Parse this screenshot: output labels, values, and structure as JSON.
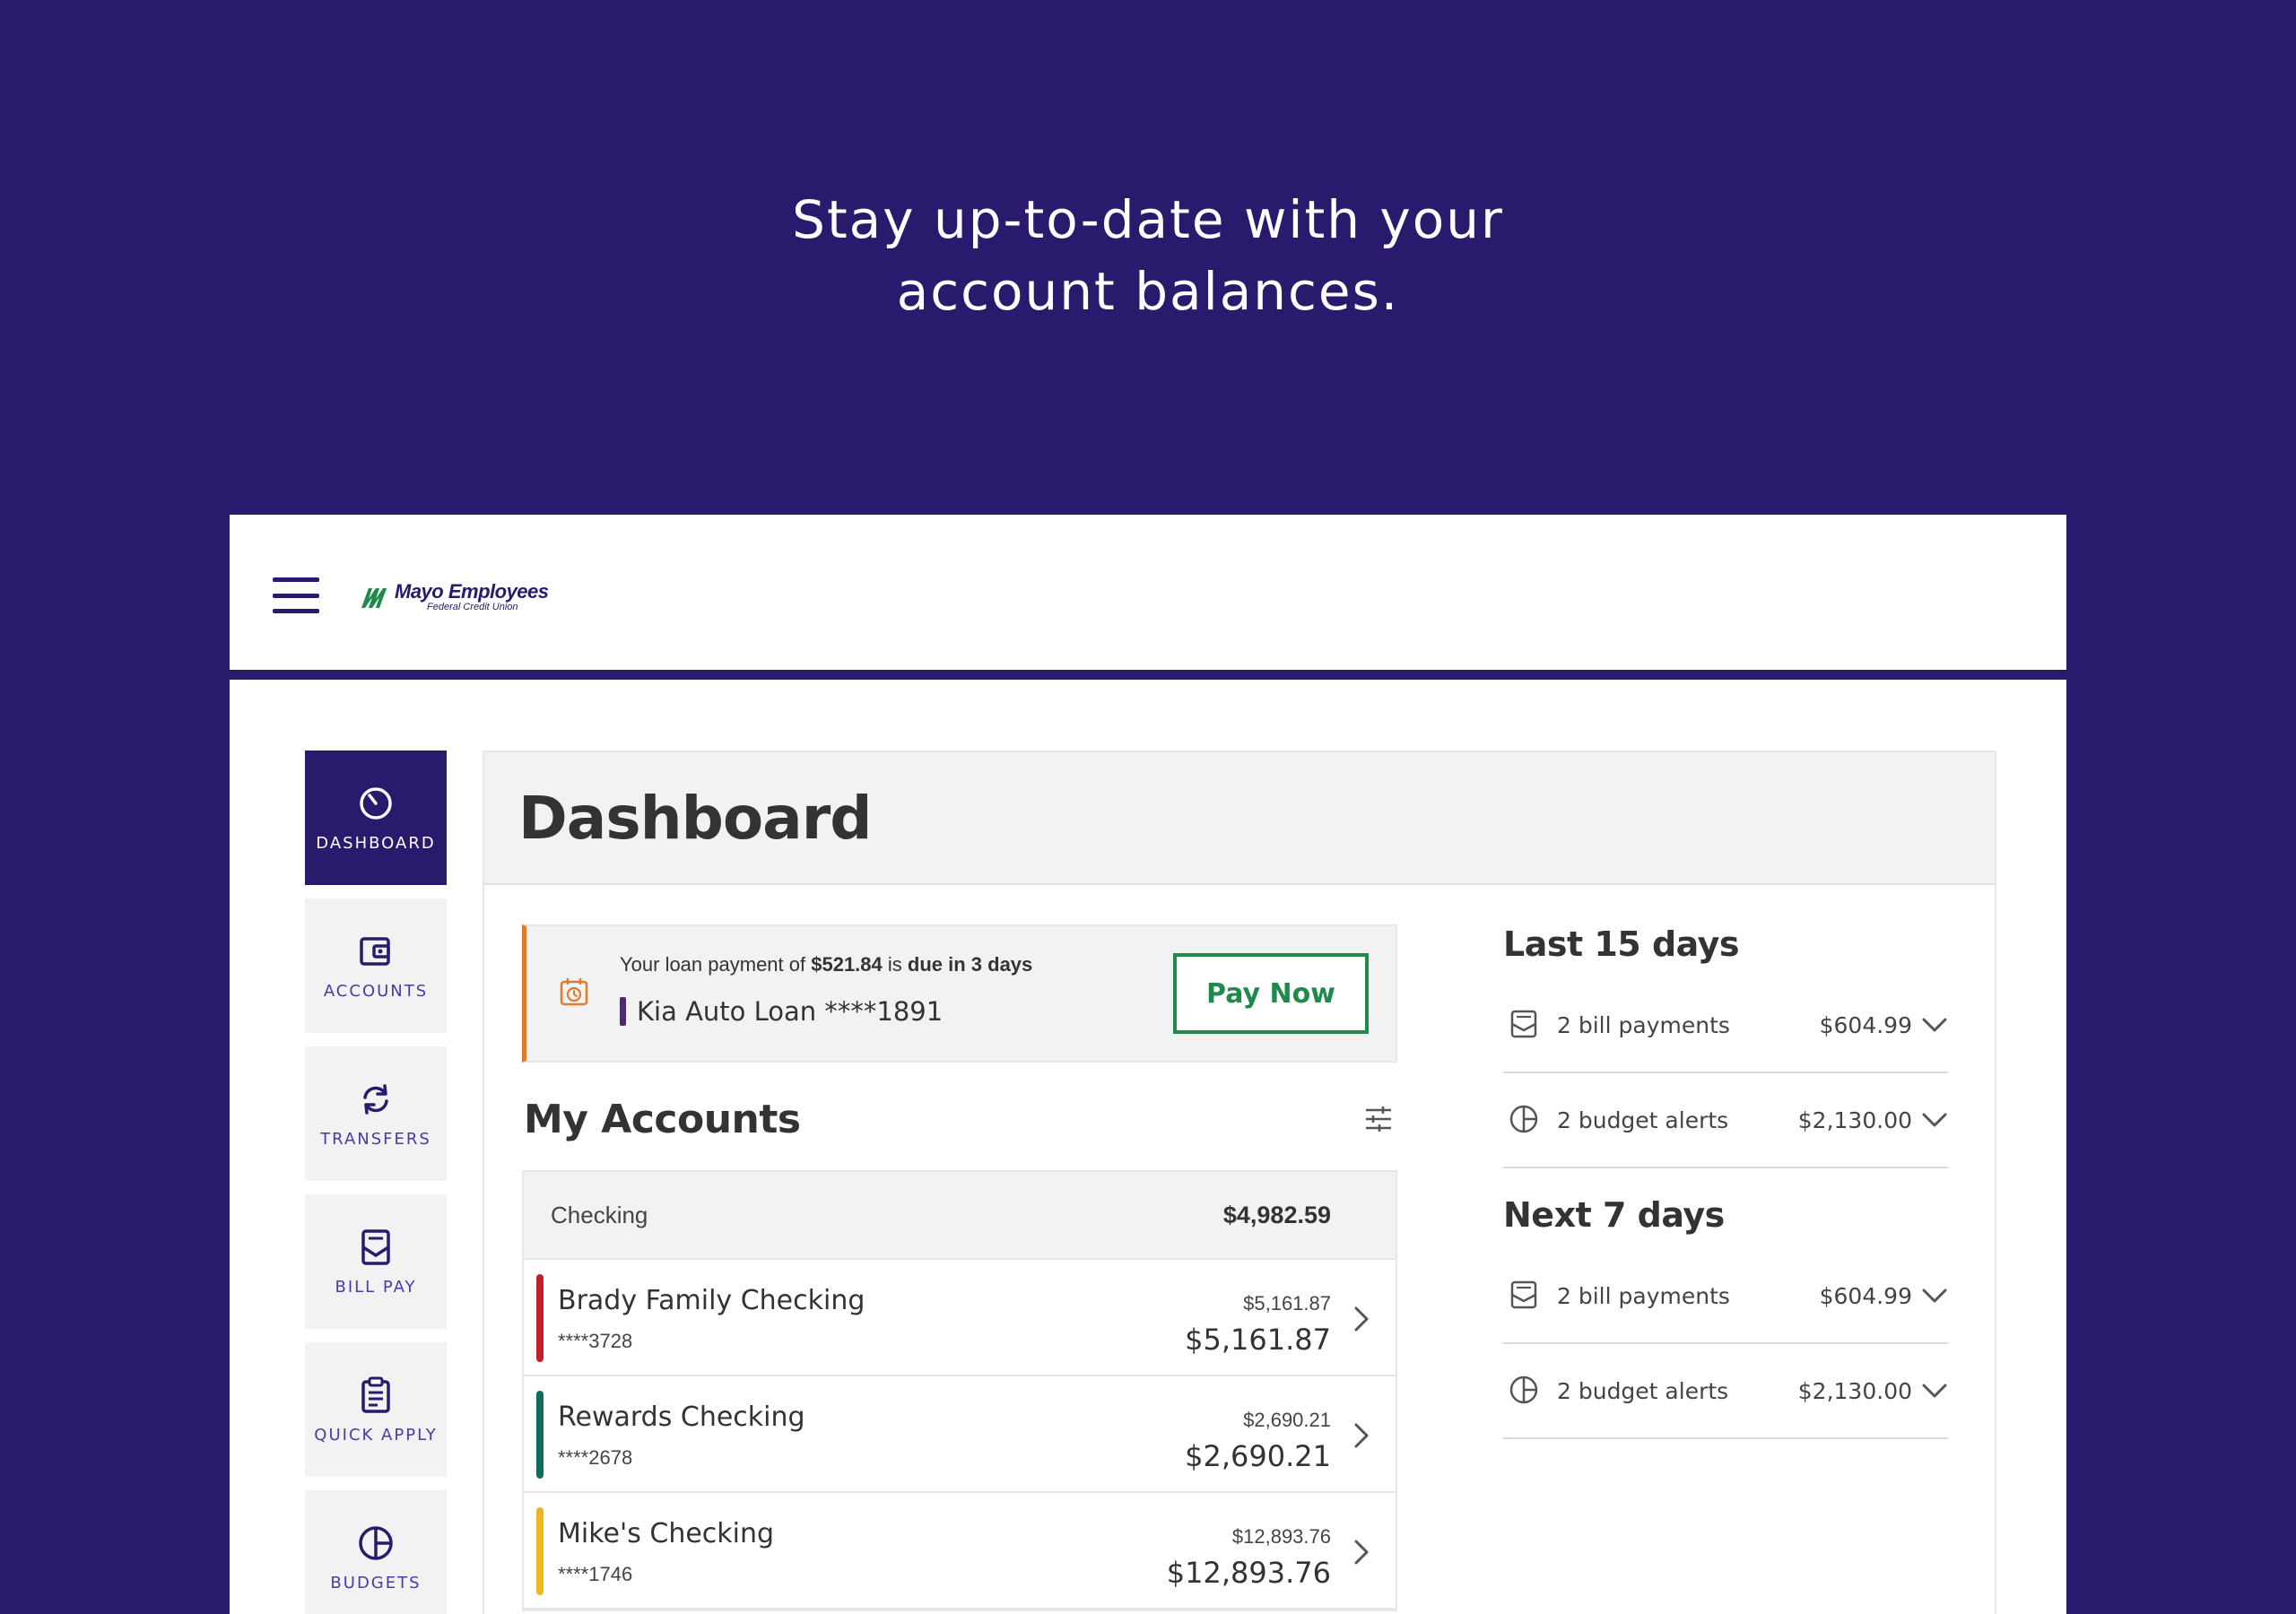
{
  "headline": {
    "line1": "Stay up-to-date with your",
    "line2": "account balances."
  },
  "brand": {
    "name": "Mayo Employees",
    "subtitle": "Federal Credit Union",
    "primary_color": "#2a1a6e",
    "logo_color": "#1f8a4c"
  },
  "nav": [
    {
      "label": "DASHBOARD",
      "icon": "gauge-icon",
      "active": true
    },
    {
      "label": "ACCOUNTS",
      "icon": "wallet-icon",
      "active": false
    },
    {
      "label": "TRANSFERS",
      "icon": "transfer-icon",
      "active": false
    },
    {
      "label": "BILL PAY",
      "icon": "bill-icon",
      "active": false
    },
    {
      "label": "QUICK APPLY",
      "icon": "clipboard-icon",
      "active": false
    },
    {
      "label": "BUDGETS",
      "icon": "pie-icon",
      "active": false
    }
  ],
  "page": {
    "title": "Dashboard"
  },
  "loan_alert": {
    "prefix": "Your loan payment of ",
    "amount": "$521.84",
    "middle": " is ",
    "due": "due in 3 days",
    "loan_name": "Kia Auto Loan ****1891",
    "button": "Pay Now",
    "accent_color": "#e07a2e"
  },
  "accounts": {
    "title": "My Accounts",
    "group": {
      "name": "Checking",
      "total": "$4,982.59"
    },
    "rows": [
      {
        "name": "Brady Family Checking",
        "number": "****3728",
        "available": "$5,161.87",
        "balance": "$5,161.87",
        "color": "#c0202a"
      },
      {
        "name": "Rewards Checking",
        "number": "****2678",
        "available": "$2,690.21",
        "balance": "$2,690.21",
        "color": "#0f6b5a"
      },
      {
        "name": "Mike's Checking",
        "number": "****1746",
        "available": "$12,893.76",
        "balance": "$12,893.76",
        "color": "#f0b41e"
      }
    ]
  },
  "summary": {
    "last": {
      "title": "Last 15 days",
      "items": [
        {
          "label": "2 bill payments",
          "amount": "$604.99",
          "icon": "bill-icon"
        },
        {
          "label": "2 budget alerts",
          "amount": "$2,130.00",
          "icon": "pie-icon"
        }
      ]
    },
    "next": {
      "title": "Next 7 days",
      "items": [
        {
          "label": "2 bill payments",
          "amount": "$604.99",
          "icon": "bill-icon"
        },
        {
          "label": "2 budget alerts",
          "amount": "$2,130.00",
          "icon": "pie-icon"
        }
      ]
    }
  }
}
